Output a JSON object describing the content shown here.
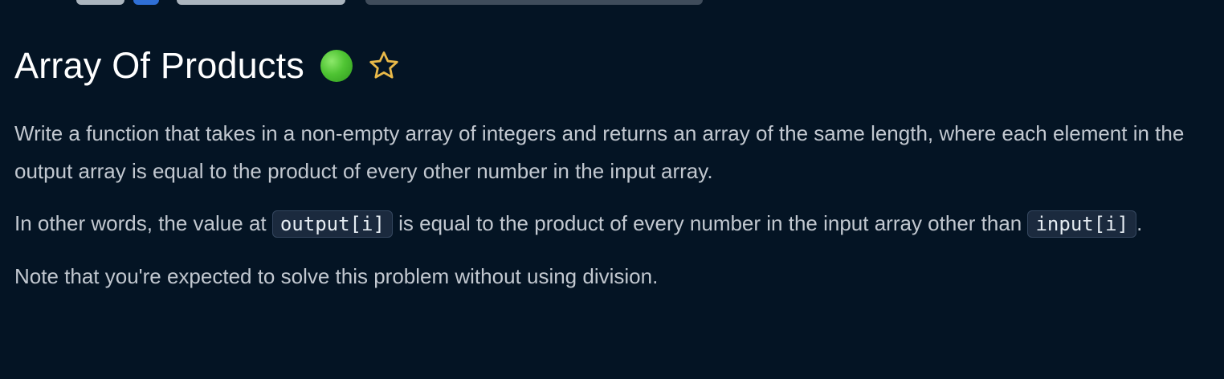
{
  "problem": {
    "title": "Array Of Products",
    "status_color": "#4fc433",
    "status_icon": "green-circle-difficulty-icon",
    "favorite_icon": "star-outline-icon",
    "favorite_color": "#e9b949"
  },
  "description": {
    "paragraph1": "Write a function that takes in a non-empty array of integers and returns an array of the same length, where each element in the output array is equal to the product of every other number in the input array.",
    "paragraph2": {
      "before": "In other words, the value at ",
      "code1": "output[i]",
      "middle": " is equal to the product of every number in the input array other than ",
      "code2": "input[i]",
      "after": "."
    },
    "paragraph3": "Note that you're expected to solve this problem without using division."
  }
}
